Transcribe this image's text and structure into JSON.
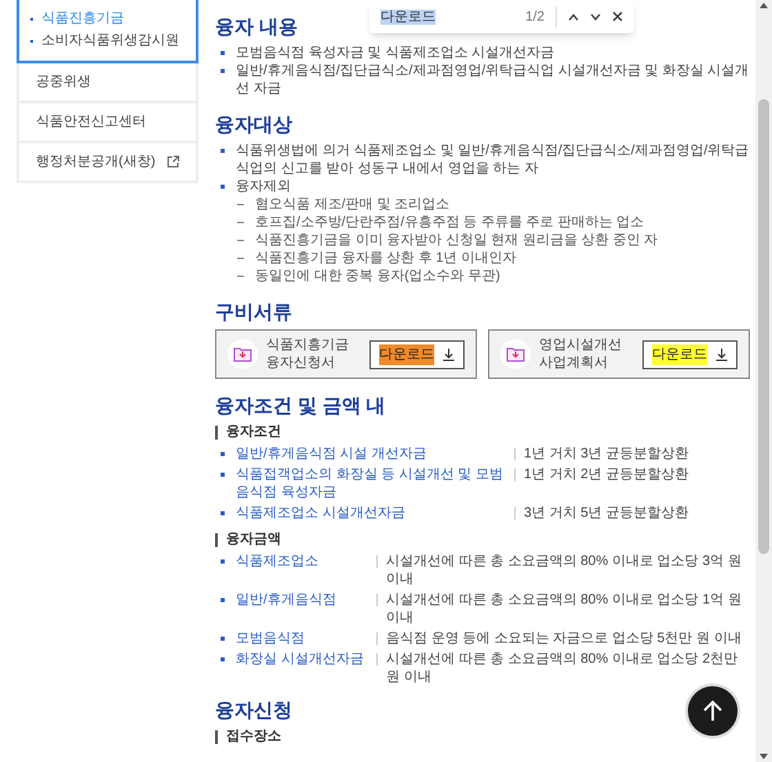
{
  "sidebar": {
    "items": [
      {
        "selected": true,
        "children": [
          {
            "label": "식품진흥기금",
            "selected": true
          },
          {
            "label": "소비자식품위생감시원",
            "selected": false
          }
        ]
      },
      {
        "label": "공중위생",
        "selected": false,
        "external": false
      },
      {
        "label": "식품안전신고센터",
        "selected": false,
        "external": false
      },
      {
        "label": "행정처분공개(새창)",
        "selected": false,
        "external": true
      }
    ]
  },
  "find_bar": {
    "query": "다운로드",
    "count": "1/2"
  },
  "sections": [
    {
      "kind": "bullets",
      "title": "융자 내용",
      "items": [
        {
          "text": "모범음식점 육성자금 및 식품제조업소 시설개선자금"
        },
        {
          "text": "일반/휴게음식점/집단급식소/제과점영업/위탁급식업 시설개선자금 및 화장실 시설개선 자금"
        }
      ]
    },
    {
      "kind": "bullets",
      "title": "융자대상",
      "items": [
        {
          "text": "식품위생법에 의거 식품제조업소 및 일반/휴게음식점/집단급식소/제과점영업/위탁급식업의 신고를 받아 성동구 내에서 영업을 하는 자"
        },
        {
          "text": "융자제외",
          "children": [
            "혐오식품 제조/판매 및 조리업소",
            "호프집/소주방/단란주점/유흥주점 등 주류를 주로 판매하는 업소",
            "식품진흥기금을 이미 융자받아 신청일 현재 원리금을 상환 중인 자",
            "식품진흥기금 융자를 상환 후 1년 이내인자",
            "동일인에 대한 중복 융자(업소수와 무관)"
          ]
        }
      ]
    },
    {
      "kind": "documents",
      "title": "구비서류",
      "documents": [
        {
          "title": [
            "식품지흥기금",
            "융자신청서"
          ],
          "button": "다운로드",
          "current_match": true
        },
        {
          "title": [
            "영업시설개선",
            "사업계획서"
          ],
          "button": "다운로드",
          "current_match": false
        }
      ]
    },
    {
      "kind": "tables",
      "title": "융자조건 및 금액 내",
      "groups": [
        {
          "title": "융자조건",
          "rows": [
            {
              "label": "일반/휴게음식점 시설 개선자금",
              "value": "1년 거치 3년 균등분할상환"
            },
            {
              "label": "식품접객업소의 화장실 등 시설개선 및 모범음식점 육성자금",
              "value": "1년 거치 2년 균등분할상환"
            },
            {
              "label": "식품제조업소 시설개선자금",
              "value": "3년 거치 5년 균등분할상환"
            }
          ]
        },
        {
          "title": "융자금액",
          "rows": [
            {
              "label": "식품제조업소",
              "value": "시설개선에 따른 총 소요금액의 80% 이내로 업소당 3억 원 이내"
            },
            {
              "label": "일반/휴게음식점",
              "value": "시설개선에 따른 총 소요금액의 80% 이내로 업소당 1억 원 이내"
            },
            {
              "label": "모범음식점",
              "value": "음식점 운영 등에 소요되는 자금으로 업소당 5천만 원 이내"
            },
            {
              "label": "화장실 시설개선자금",
              "value": "시설개선에 따른 총 소요금액의 80% 이내로 업소당 2천만 원 이내"
            }
          ]
        }
      ]
    },
    {
      "kind": "tables",
      "title": "융자신청",
      "groups": [
        {
          "title": "접수장소"
        }
      ]
    }
  ]
}
